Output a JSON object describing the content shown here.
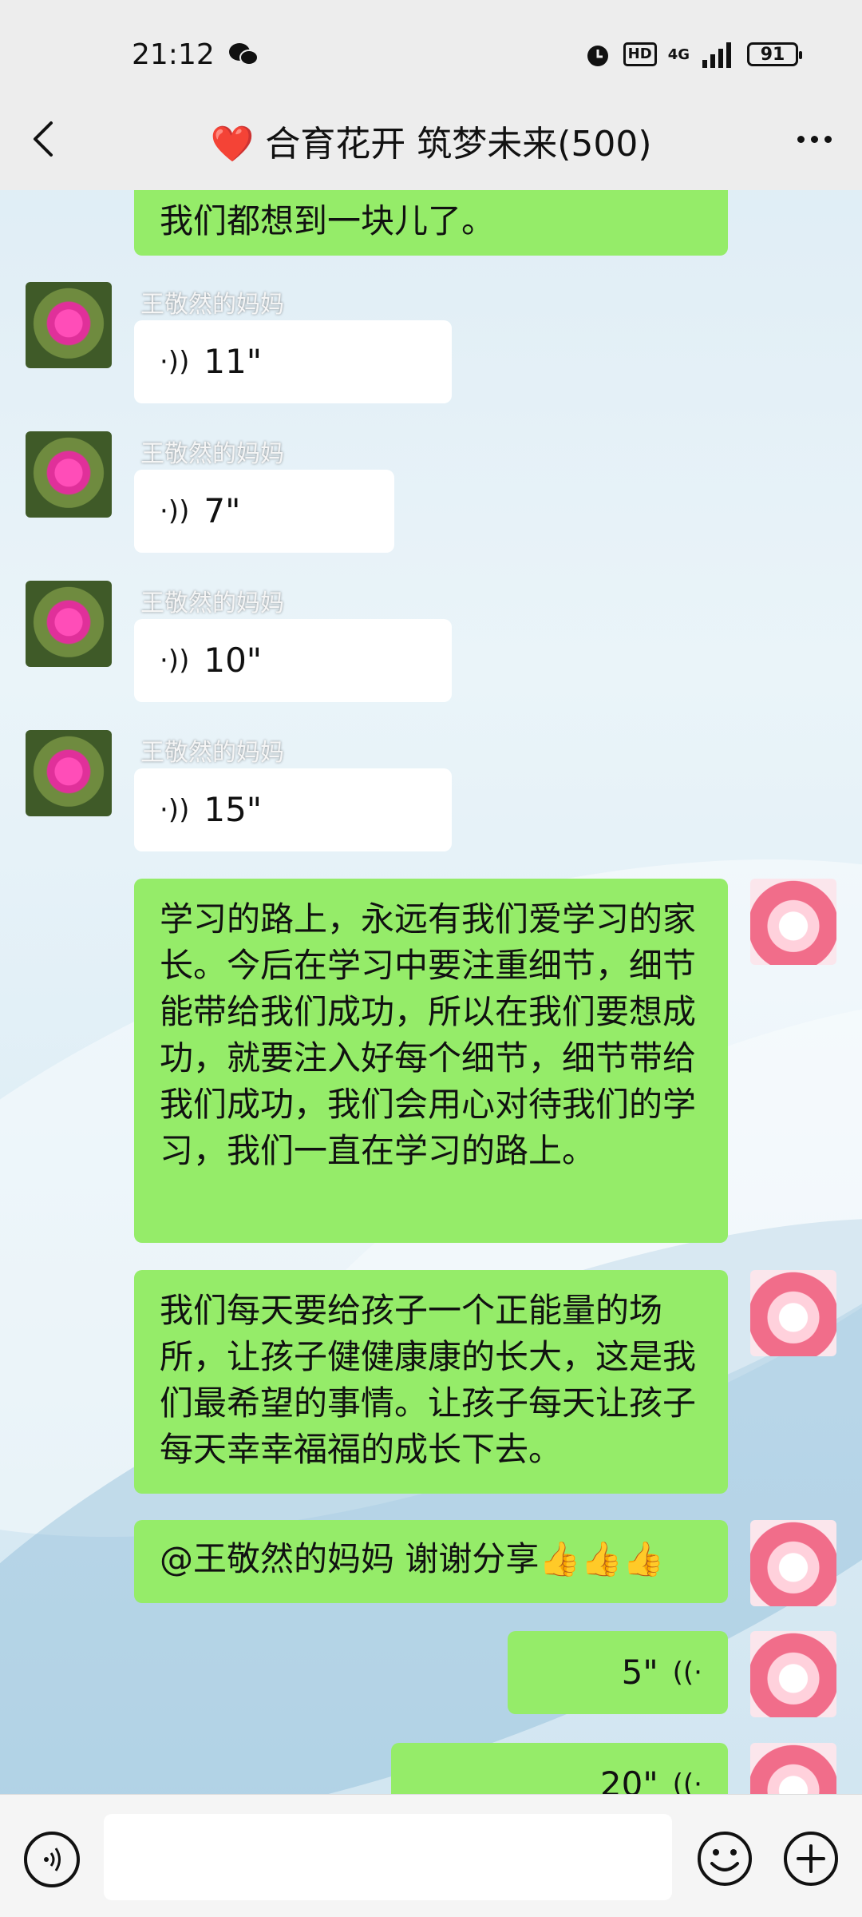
{
  "status": {
    "time": "21:12",
    "hd": "HD",
    "network": "4G",
    "battery": "91"
  },
  "header": {
    "title": "❤️ 合育花开 筑梦未来(500)"
  },
  "messages": [
    {
      "type": "text",
      "side": "right",
      "text": "我们都想到一块儿了。"
    },
    {
      "type": "voice",
      "side": "left",
      "sender": "王敬然的妈妈",
      "duration": "11\""
    },
    {
      "type": "voice",
      "side": "left",
      "sender": "王敬然的妈妈",
      "duration": "7\""
    },
    {
      "type": "voice",
      "side": "left",
      "sender": "王敬然的妈妈",
      "duration": "10\""
    },
    {
      "type": "voice",
      "side": "left",
      "sender": "王敬然的妈妈",
      "duration": "15\""
    },
    {
      "type": "text",
      "side": "right",
      "text": "学习的路上，永远有我们爱学习的家长。今后在学习中要注重细节，细节能带给我们成功，所以在我们要想成功，就要注入好每个细节，细节带给我们成功，我们会用心对待我们的学习，我们一直在学习的路上。"
    },
    {
      "type": "text",
      "side": "right",
      "text": "我们每天要给孩子一个正能量的场所，让孩子健健康康的长大，这是我们最希望的事情。让孩子每天让孩子每天幸幸福福的成长下去。"
    },
    {
      "type": "text",
      "side": "right",
      "text": "@王敬然的妈妈  谢谢分享👍👍👍"
    },
    {
      "type": "voice",
      "side": "right",
      "duration": "5\""
    },
    {
      "type": "voice",
      "side": "right",
      "duration": "20\""
    }
  ],
  "icons": {
    "back": "chevron-left-icon",
    "more": "more-dots-icon",
    "voice_wave": "voice-wave-icon",
    "emoji": "emoji-icon",
    "plus": "plus-icon"
  },
  "colors": {
    "bubble_green": "#95ec69",
    "bubble_white": "#ffffff",
    "bar_bg": "#ededed"
  }
}
